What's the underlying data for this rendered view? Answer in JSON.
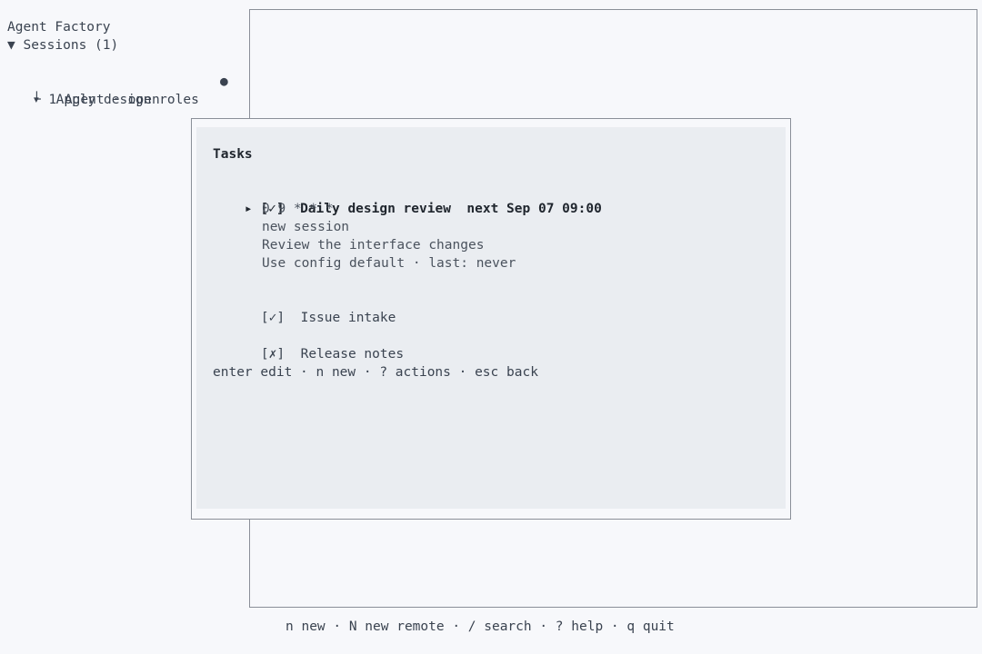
{
  "app": {
    "title": "Agent Factory"
  },
  "sidebar": {
    "sessions_header": "▼ Sessions (1)",
    "session": {
      "arrow": "▾",
      "title": "Apply design roles",
      "status_dot": "●",
      "child": "└ 1 Agent · open"
    }
  },
  "modal": {
    "title": "Tasks",
    "tasks": [
      {
        "pointer": "▸",
        "check": "[✓]",
        "name": "Daily design review",
        "next": "next Sep 07 09:00",
        "details": [
          "0 9 * * *",
          "new session",
          "Review the interface changes",
          "Use config default · last: never"
        ]
      },
      {
        "pointer": "",
        "check": "[✓]",
        "name": "Issue intake"
      },
      {
        "pointer": "",
        "check": "[✗]",
        "name": "Release notes"
      }
    ],
    "hint": "enter edit · n new · ? actions · esc back"
  },
  "footer": {
    "hint": "n new · N new remote · / search · ? help · q quit"
  }
}
